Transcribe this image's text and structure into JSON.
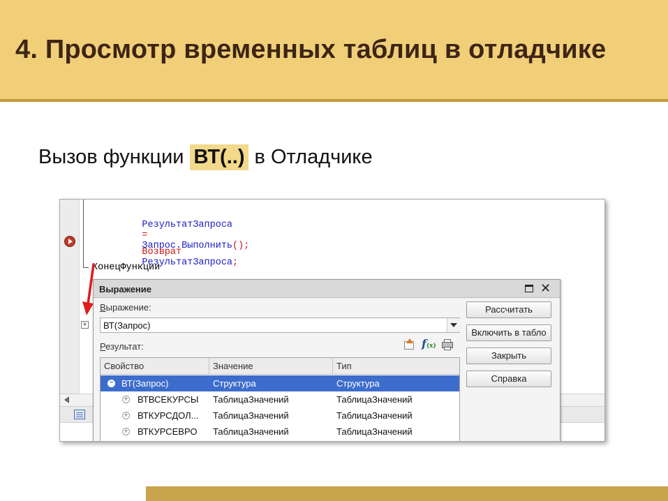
{
  "slide": {
    "title": "4. Просмотр временных таблиц в отладчике",
    "subtitle_prefix": "Вызов функции",
    "subtitle_highlight": "ВТ(..)",
    "subtitle_suffix": "в Отладчике"
  },
  "code": {
    "line1": {
      "var": "РезультатЗапроса",
      "op": "=",
      "call": "Запрос.Выполнить",
      "tail": "();"
    },
    "line2": {
      "keyword": "Возврат",
      "var": "РезультатЗапроса",
      "tail": ";"
    },
    "line3": "КонецФункции"
  },
  "dialog": {
    "title": "Выражение",
    "expression_label_first": "В",
    "expression_label_rest": "ыражение:",
    "expression_value": "ВТ(Запрос)",
    "result_label_first": "Р",
    "result_label_rest": "езультат:",
    "columns": [
      "Свойство",
      "Значение",
      "Тип"
    ],
    "rows": [
      {
        "property": "ВТ(Запрос)",
        "value": "Структура",
        "type": "Структура",
        "selected": true,
        "toggle": "−"
      },
      {
        "property": "ВТВСЕКУРСЫ",
        "value": "ТаблицаЗначений",
        "type": "ТаблицаЗначений",
        "selected": false,
        "toggle": "+"
      },
      {
        "property": "ВТКУРСДОЛ...",
        "value": "ТаблицаЗначений",
        "type": "ТаблицаЗначений",
        "selected": false,
        "toggle": "+"
      },
      {
        "property": "ВТКУРСЕВРО",
        "value": "ТаблицаЗначений",
        "type": "ТаблицаЗначений",
        "selected": false,
        "toggle": "+"
      }
    ],
    "buttons": {
      "calculate": "Рассчитать",
      "add_to_watch": "Включить в табло",
      "close": "Закрыть",
      "help": "Справка"
    },
    "function_icon_label": "f",
    "function_icon_sub": "(x)"
  },
  "colors": {
    "header_bg": "#f0cf78",
    "title_text": "#3d2515",
    "highlight": "#f3d98a",
    "selection": "#3d6dcc",
    "arrow": "#e01b1b"
  }
}
